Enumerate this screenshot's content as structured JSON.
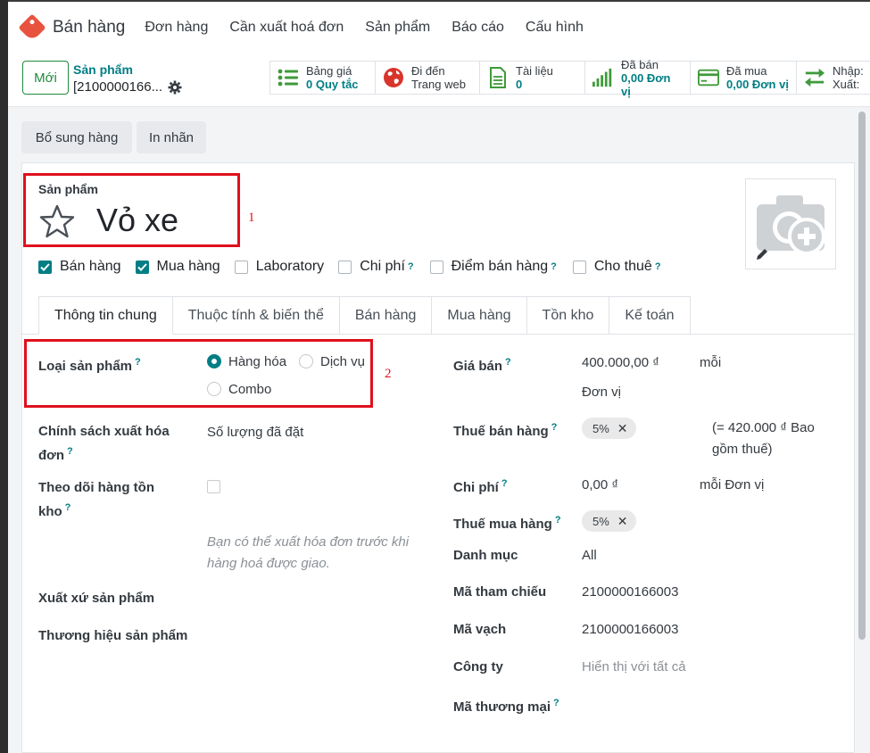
{
  "topnav": {
    "app_name": "Bán hàng",
    "menu": [
      "Đơn hàng",
      "Cần xuất hoá đơn",
      "Sản phẩm",
      "Báo cáo",
      "Cấu hình"
    ]
  },
  "control": {
    "new_label": "Mới",
    "breadcrumb_parent": "Sản phẩm",
    "breadcrumb_current": "[2100000166...",
    "smart_buttons": [
      {
        "line1": "Bảng giá",
        "line2": "0 Quy tắc",
        "icon": "list-icon"
      },
      {
        "line1": "Đi đến",
        "line2": "Trang web",
        "icon": "globe-icon"
      },
      {
        "line1": "Tài liệu",
        "line2": "0",
        "icon": "document-icon"
      },
      {
        "line1": "Đã bán",
        "line2": "0,00 Đơn vị",
        "icon": "signal-bars-icon"
      },
      {
        "line1": "Đã mua",
        "line2": "0,00 Đơn vị",
        "icon": "credit-card-icon"
      },
      {
        "line1": "Nhập:",
        "line2": "Xuất:",
        "icon": "transfer-arrows-icon"
      }
    ]
  },
  "actions": {
    "replenish": "Bổ sung hàng",
    "print_labels": "In nhãn"
  },
  "product": {
    "label": "Sản phẩm",
    "name": "Vỏ xe",
    "annotation_1": "1",
    "annotation_2": "2"
  },
  "checkboxes": [
    {
      "label": "Bán hàng",
      "checked": true,
      "help": ""
    },
    {
      "label": "Mua hàng",
      "checked": true,
      "help": ""
    },
    {
      "label": "Laboratory",
      "checked": false,
      "help": ""
    },
    {
      "label": "Chi phí",
      "checked": false,
      "help": "?"
    },
    {
      "label": "Điểm bán hàng",
      "checked": false,
      "help": "?"
    },
    {
      "label": "Cho thuê",
      "checked": false,
      "help": "?"
    }
  ],
  "tabs": [
    "Thông tin chung",
    "Thuộc tính & biến thể",
    "Bán hàng",
    "Mua hàng",
    "Tồn kho",
    "Kế toán"
  ],
  "left": {
    "product_type_label": "Loại sản phẩm",
    "type_goods": "Hàng hóa",
    "type_service": "Dịch vụ",
    "type_combo": "Combo",
    "invoice_policy_label_1": "Chính sách xuất hóa",
    "invoice_policy_label_2": "đơn",
    "invoice_policy_value": "Số lượng đã đặt",
    "track_inventory_label_1": "Theo dõi hàng tồn",
    "track_inventory_label_2": "kho",
    "hint_1": "Bạn có thể xuất hóa đơn trước khi",
    "hint_2": "hàng hoá được giao.",
    "origin_label": "Xuất xứ sản phẩm",
    "brand_label": "Thương hiệu sản phẩm"
  },
  "right": {
    "price_label": "Giá bán",
    "price_value": "400.000,00 ₫",
    "price_per": "mỗi",
    "price_unit": "Đơn vị",
    "sales_tax_label": "Thuế bán hàng",
    "sales_tax_badge": "5%",
    "tax_included_1": "(= 420.000 ₫ Bao",
    "tax_included_2": "gồm thuế)",
    "cost_label": "Chi phí",
    "cost_value": "0,00 ₫",
    "cost_per": "mỗi Đơn vị",
    "purchase_tax_label": "Thuế mua hàng",
    "purchase_tax_badge": "5%",
    "category_label": "Danh mục",
    "category_value": "All",
    "ref_label": "Mã tham chiếu",
    "ref_value": "2100000166003",
    "barcode_label": "Mã vạch",
    "barcode_value": "2100000166003",
    "company_label": "Công ty",
    "company_placeholder": "Hiển thị với tất cả",
    "trade_code_label": "Mã thương mại"
  },
  "colors": {
    "accent": "#017e84",
    "annotation": "#e0101d",
    "new_button": "#1e8a3a"
  }
}
